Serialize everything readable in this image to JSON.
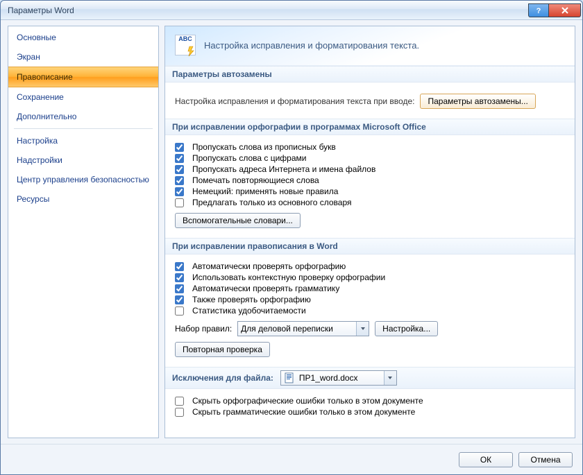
{
  "window": {
    "title": "Параметры Word"
  },
  "sidebar": {
    "items": [
      {
        "label": "Основные"
      },
      {
        "label": "Экран"
      },
      {
        "label": "Правописание",
        "selected": true
      },
      {
        "label": "Сохранение"
      },
      {
        "label": "Дополнительно"
      },
      {
        "label": "Настройка"
      },
      {
        "label": "Надстройки"
      },
      {
        "label": "Центр управления безопасностью"
      },
      {
        "label": "Ресурсы"
      }
    ]
  },
  "hero": {
    "heading": "Настройка исправления и форматирования текста."
  },
  "sections": {
    "autocorrect": {
      "title": "Параметры автозамены",
      "description": "Настройка исправления и форматирования текста при вводе:",
      "button": "Параметры автозамены..."
    },
    "office_spell": {
      "title": "При исправлении орфографии в программах Microsoft Office",
      "checks": [
        {
          "label": "Пропускать слова из прописных букв",
          "checked": true
        },
        {
          "label": "Пропускать слова с цифрами",
          "checked": true
        },
        {
          "label": "Пропускать адреса Интернета и имена файлов",
          "checked": true
        },
        {
          "label": "Помечать повторяющиеся слова",
          "checked": true
        },
        {
          "label": "Немецкий: применять новые правила",
          "checked": true
        },
        {
          "label": "Предлагать только из основного словаря",
          "checked": false
        }
      ],
      "dict_button": "Вспомогательные словари..."
    },
    "word_spell": {
      "title": "При исправлении правописания в Word",
      "checks": [
        {
          "label": "Автоматически проверять орфографию",
          "checked": true
        },
        {
          "label": "Использовать контекстную проверку орфографии",
          "checked": true
        },
        {
          "label": "Автоматически проверять грамматику",
          "checked": true
        },
        {
          "label": "Также проверять орфографию",
          "checked": true
        },
        {
          "label": "Статистика удобочитаемости",
          "checked": false
        }
      ],
      "rules_label": "Набор правил:",
      "rules_value": "Для деловой переписки",
      "settings_button": "Настройка...",
      "recheck_button": "Повторная проверка"
    },
    "exceptions": {
      "title": "Исключения для файла:",
      "file_value": "ПР1_word.docx",
      "checks": [
        {
          "label": "Скрыть орфографические ошибки только в этом документе",
          "checked": false
        },
        {
          "label": "Скрыть грамматические ошибки только в этом документе",
          "checked": false
        }
      ]
    }
  },
  "footer": {
    "ok": "ОК",
    "cancel": "Отмена"
  }
}
